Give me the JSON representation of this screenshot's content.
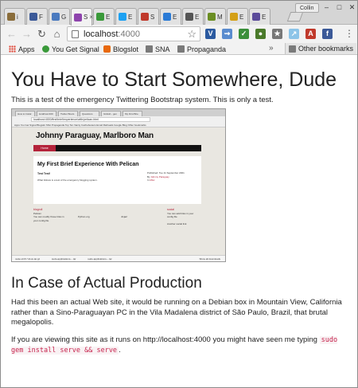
{
  "browser": {
    "tabs": [
      {
        "letter": "i",
        "color": "#8a6d3b",
        "active": false
      },
      {
        "letter": "F",
        "color": "#3b5998",
        "active": false
      },
      {
        "letter": "G",
        "color": "#4a7abf",
        "active": false
      },
      {
        "letter": "S",
        "color": "#8e44ad",
        "active": true
      },
      {
        "letter": "E",
        "color": "#3a9a3a",
        "active": false
      },
      {
        "letter": "E",
        "color": "#1da1f2",
        "active": false
      },
      {
        "letter": "S",
        "color": "#c0392b",
        "active": false
      },
      {
        "letter": "E",
        "color": "#2b7bd6",
        "active": false
      },
      {
        "letter": "E",
        "color": "#555555",
        "active": false
      },
      {
        "letter": "M",
        "color": "#6b8e23",
        "active": false
      },
      {
        "letter": "E",
        "color": "#d4a017",
        "active": false
      },
      {
        "letter": "E",
        "color": "#5b4b9a",
        "active": false
      }
    ],
    "profile_name": "Collin",
    "url_host": "localhost",
    "url_port": ":4000",
    "bookmarks": {
      "apps": "Apps",
      "items": [
        "You Get Signal",
        "Blogslot",
        "SNA",
        "Propaganda"
      ],
      "other": "Other bookmarks"
    },
    "extensions": [
      {
        "glyph": "V",
        "color": "#2b5aa0"
      },
      {
        "glyph": "⇝",
        "color": "#5a8ccf"
      },
      {
        "glyph": "✓",
        "color": "#3a8f3a"
      },
      {
        "glyph": "●",
        "color": "#4a7a2a"
      },
      {
        "glyph": "★",
        "color": "#777777"
      },
      {
        "glyph": "↗",
        "color": "#8cc4e8"
      },
      {
        "glyph": "A",
        "color": "#c0392b"
      },
      {
        "glyph": "f",
        "color": "#3b5998"
      }
    ]
  },
  "page": {
    "heading": "You Have to Start Somewhere, Dude",
    "intro": "This is a test of the emergency Twittering Bootstrap system. This is only a test.",
    "section_heading": "In Case of Actual Production",
    "para1": "Had this been an actual Web site, it would be running on a Debian box in Mountain View, California rather than a Sino-Paraguayan PC in the Vila Madalena district of São Paulo, Brazil, that brutal megalopolis.",
    "para2_prefix": "If you are viewing this site as it runs on http://localhost:4000 you might have seen me typing ",
    "para2_code": "sudo gem install serve && serve",
    "para2_suffix": "."
  },
  "screenshot": {
    "tabs": [
      "How to Instal",
      "localhost:400",
      "Twitter Boots",
      "Questions",
      "GitHub - gen",
      "My First Brie"
    ],
    "url": "localhost:4000/first/brief/experience/with/pelican.html",
    "bookmarks": "Apps   You Get Signal   Blogslot   SNA   Propaganda   Top Ten   Vanity   Cachebusters   Email Railroads   Google Blog   Other bookmarks",
    "site_title": "Johnny Paraguay, Marlboro Man",
    "nav_item": "Home",
    "post_title": "My First Brief Experience With Pelican",
    "post_subtitle": "Test Test!",
    "post_text": "What follows is a test of the emergency blogging system.",
    "meta_published": "Published: Tue 11 September 2001",
    "meta_by": "By ",
    "meta_author": "Johnny Paraguay",
    "meta_in": "In ",
    "meta_category": "Misc",
    "blogroll_heading": "blogroll",
    "blogroll_items": [
      "Pelican",
      "You can modify those links in your config file"
    ],
    "python_org": "Python.org",
    "jinja2": "Jinja2",
    "social_heading": "social",
    "social_items": [
      "You can add links in your config file",
      "Another social link"
    ],
    "downloads": [
      "node-v0.8.7-linux.tar.gz",
      "sudo-applications-...tar",
      "sudo-applications-...tar"
    ],
    "show_all": "Show all downloads"
  }
}
